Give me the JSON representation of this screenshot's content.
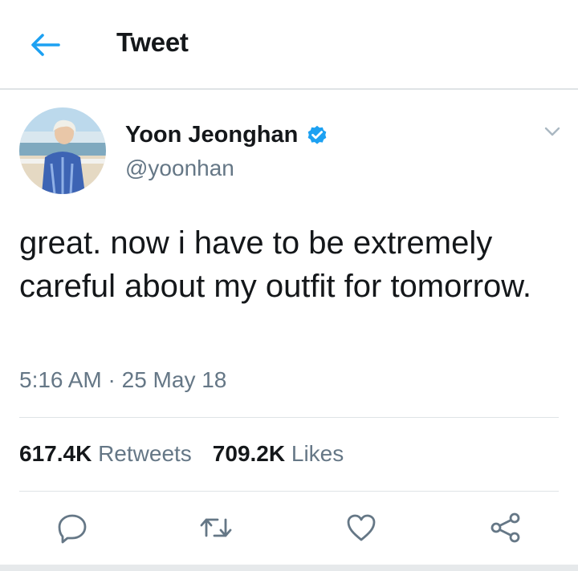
{
  "header": {
    "title": "Tweet",
    "back_icon": "arrow-left-icon",
    "accent": "#1da1f2"
  },
  "tweet": {
    "author_name": "Yoon Jeonghan",
    "handle": "@yoonhan",
    "verified": true,
    "text": "great. now i have to be extremely careful about my outfit for tomorrow.",
    "time": "5:16 AM",
    "date_sep": "·",
    "date": "25 May 18"
  },
  "stats": {
    "retweets_count": "617.4K",
    "retweets_label": "Retweets",
    "likes_count": "709.2K",
    "likes_label": "Likes"
  },
  "actions": [
    "reply-icon",
    "retweet-icon",
    "like-icon",
    "share-icon"
  ],
  "colors": {
    "text": "#14171a",
    "secondary": "#657786",
    "divider": "#dfe3e6",
    "verified": "#1da1f2"
  }
}
